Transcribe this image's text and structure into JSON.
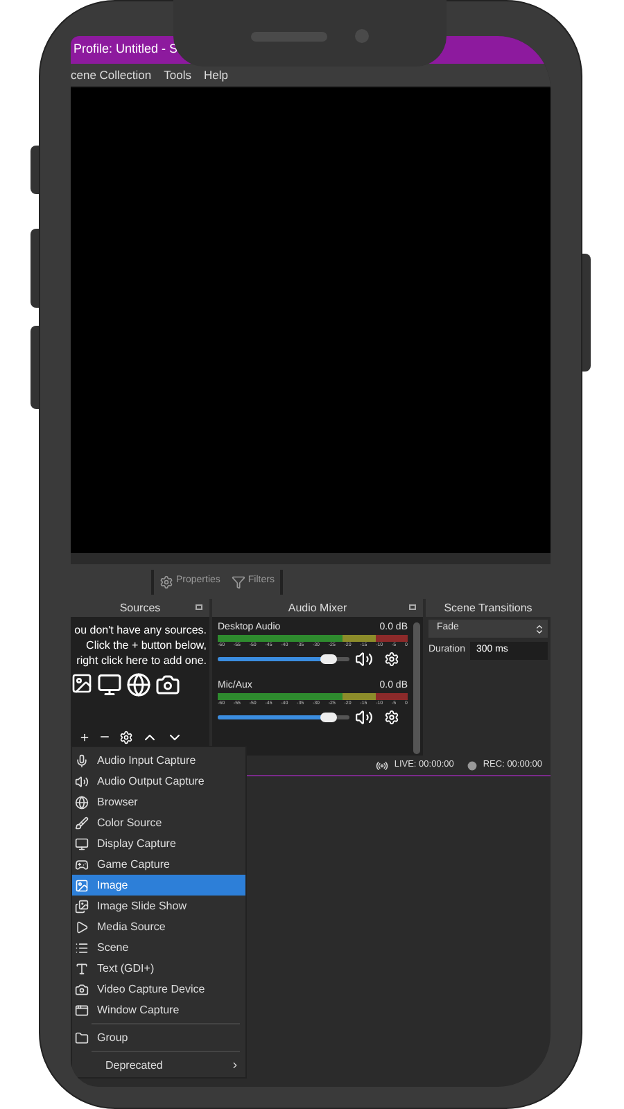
{
  "window": {
    "title": "Profile: Untitled - S"
  },
  "menu_bar": [
    "cene Collection",
    "Tools",
    "Help"
  ],
  "toolbar": [
    {
      "kind": "gear",
      "label": "Properties"
    },
    {
      "kind": "filter",
      "label": "Filters"
    }
  ],
  "sources": {
    "title": "Sources",
    "message": [
      "ou don't have any sources.",
      "Click the + button below,",
      "right click here to add one."
    ]
  },
  "audio_mixer": {
    "title": "Audio Mixer",
    "channels": [
      {
        "name": "Desktop Audio",
        "reading": "0.0 dB",
        "level": 0.88,
        "ticks": [
          "-60",
          "-55",
          "-50",
          "-45",
          "-40",
          "-35",
          "-30",
          "-25",
          "-20",
          "-15",
          "-10",
          "-5",
          "0"
        ]
      },
      {
        "name": "Mic/Aux",
        "reading": "0.0 dB",
        "level": 0.88,
        "ticks": [
          "-60",
          "-55",
          "-50",
          "-45",
          "-40",
          "-35",
          "-30",
          "-25",
          "-20",
          "-15",
          "-10",
          "-5",
          "0"
        ]
      }
    ]
  },
  "scene_transitions": {
    "title": "Scene Transitions",
    "transition": "Fade",
    "duration_label": "Duration",
    "duration": "300 ms"
  },
  "status_bar": {
    "live": "LIVE: 00:00:00",
    "rec": "REC: 00:00:00"
  },
  "context_menu": [
    {
      "kind": "mic",
      "label": "Audio Input Capture",
      "selected": false
    },
    {
      "kind": "speaker",
      "label": "Audio Output Capture",
      "selected": false
    },
    {
      "kind": "globe",
      "label": "Browser",
      "selected": false
    },
    {
      "kind": "brush",
      "label": "Color Source",
      "selected": false
    },
    {
      "kind": "monitor",
      "label": "Display Capture",
      "selected": false
    },
    {
      "kind": "gamepad",
      "label": "Game Capture",
      "selected": false
    },
    {
      "kind": "image",
      "label": "Image",
      "selected": true
    },
    {
      "kind": "slides",
      "label": "Image Slide Show",
      "selected": false
    },
    {
      "kind": "play",
      "label": "Media Source",
      "selected": false
    },
    {
      "kind": "list",
      "label": "Scene",
      "selected": false
    },
    {
      "kind": "text",
      "label": "Text (GDI+)",
      "selected": false
    },
    {
      "kind": "camera",
      "label": "Video Capture Device",
      "selected": false
    },
    {
      "kind": "window",
      "label": "Window Capture",
      "selected": false
    },
    {
      "kind": "separator"
    },
    {
      "kind": "folder",
      "label": "Group",
      "selected": false
    },
    {
      "kind": "separator"
    },
    {
      "kind": "submenu",
      "label": "Deprecated",
      "selected": false
    }
  ]
}
